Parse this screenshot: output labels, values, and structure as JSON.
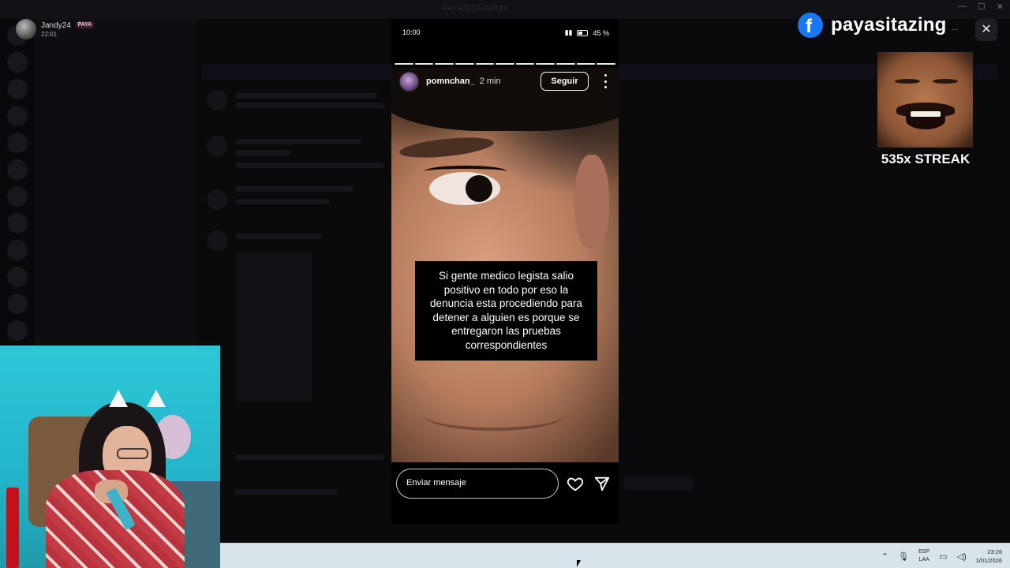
{
  "window": {
    "title": "PAYASITA ARMY"
  },
  "streamer": {
    "name": "Jandy24",
    "badge": "PAYA",
    "time": "22:01"
  },
  "phone": {
    "time": "10:00",
    "battery": "45 %",
    "battery_level": 0.45
  },
  "story": {
    "username": "pomnchan_",
    "age": "2 min",
    "follow_label": "Seguir",
    "segments_total": 11,
    "caption": "Si gente medico legista salio positivo en todo por eso la denuncia esta procediendo para detener a alguien es porque se entregaron las pruebas correspondientes",
    "message_placeholder": "Enviar mensaje"
  },
  "overlay": {
    "brand": "payasitazing",
    "streak": "535x STREAK",
    "dots": "...",
    "close_glyph": "✕"
  },
  "taskbar": {
    "lang_top": "ESP",
    "lang_bottom": "LAA",
    "clock_time": "23:26",
    "clock_date": "1/01/2026"
  },
  "colors": {
    "facebook": "#1877f2",
    "taskbar": "#d9e3ea",
    "background": "#050507"
  },
  "icons": [
    "facebook-icon",
    "more-vertical-icon",
    "heart-icon",
    "send-icon",
    "close-icon",
    "chevron-up-icon",
    "microphone-icon",
    "wifi-icon",
    "volume-icon",
    "battery-icon"
  ]
}
